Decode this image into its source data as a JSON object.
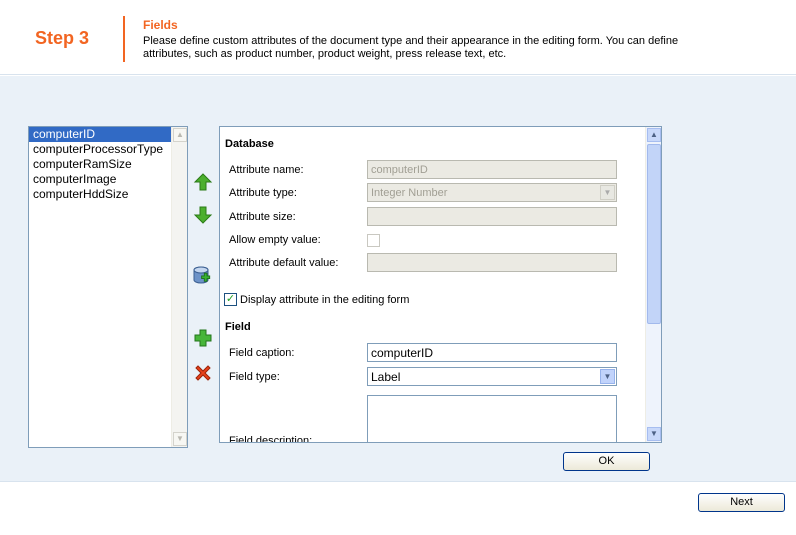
{
  "header": {
    "step": "Step 3",
    "title": "Fields",
    "description": "Please define custom attributes of the document type and their appearance in the editing form. You can define attributes, such as product number, product weight, press release text, etc."
  },
  "attributes_list": [
    "computerID",
    "computerProcessorType",
    "computerRamSize",
    "computerImage",
    "computerHddSize"
  ],
  "database": {
    "section_title": "Database",
    "attribute_name_label": "Attribute name:",
    "attribute_name_value": "computerID",
    "attribute_type_label": "Attribute type:",
    "attribute_type_value": "Integer Number",
    "attribute_size_label": "Attribute size:",
    "attribute_size_value": "",
    "allow_empty_label": "Allow empty value:",
    "allow_empty_checked": false,
    "default_value_label": "Attribute default value:",
    "default_value_value": ""
  },
  "display_in_form": {
    "label": "Display attribute in the editing form",
    "checked": true
  },
  "field": {
    "section_title": "Field",
    "caption_label": "Field caption:",
    "caption_value": "computerID",
    "type_label": "Field type:",
    "type_value": "Label",
    "description_label": "Field description:"
  },
  "buttons": {
    "ok": "OK",
    "next": "Next"
  },
  "icons": {
    "move_up": "arrow-up-icon",
    "move_down": "arrow-down-icon",
    "new_from_db": "database-add-icon",
    "add": "plus-icon",
    "delete": "delete-x-icon"
  }
}
